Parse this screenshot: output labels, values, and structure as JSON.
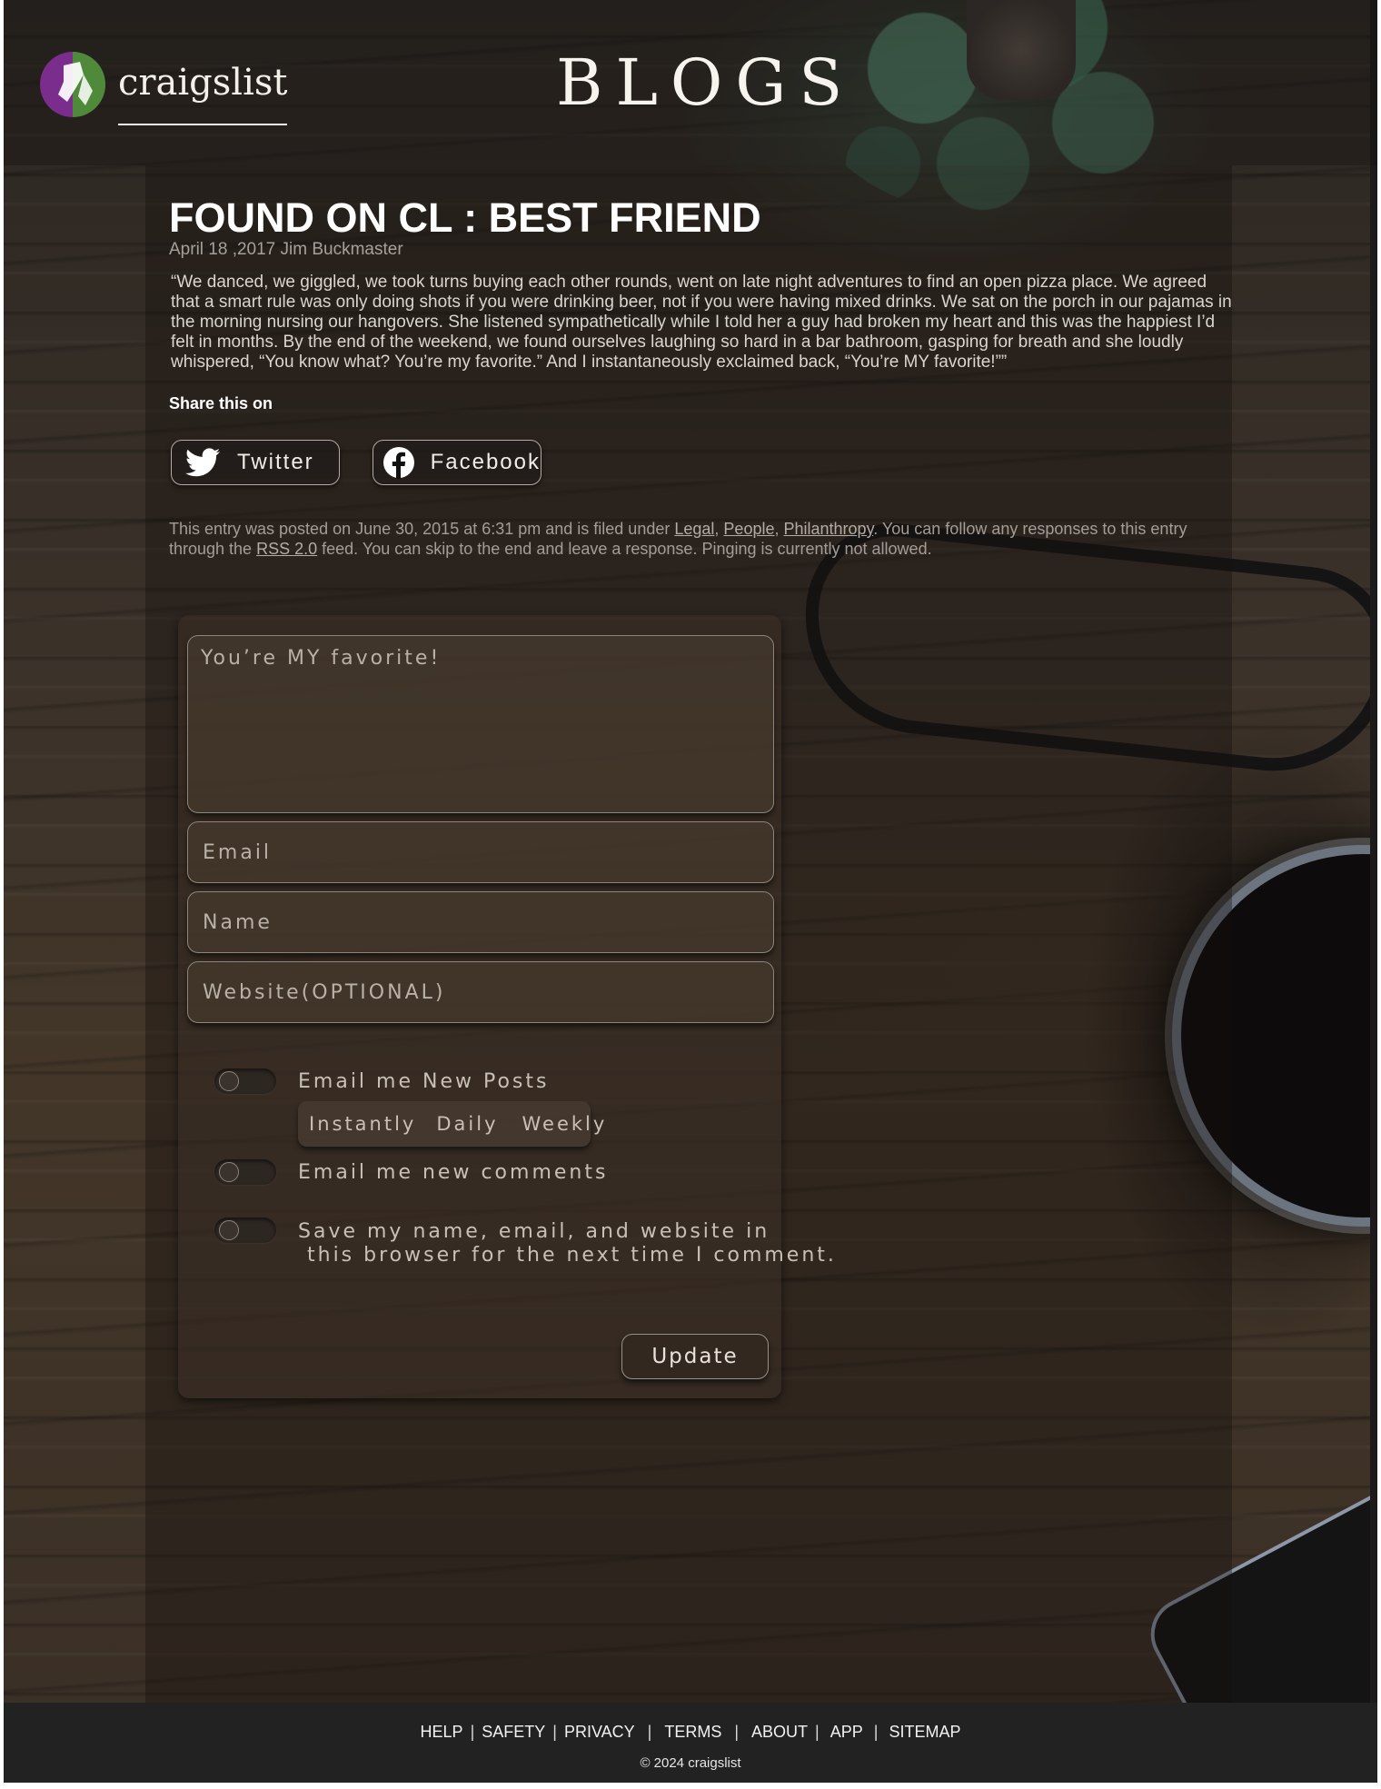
{
  "brand": {
    "name": "craigslist"
  },
  "header": {
    "title": "BLOGS"
  },
  "post": {
    "title": "FOUND ON CL : BEST FRIEND",
    "meta": "April 18 ,2017 Jim Buckmaster",
    "body": "“We danced, we giggled, we took turns buying each other rounds, went on late night adventures to find an open pizza place. We agreed that a smart rule was only doing shots if you were drinking beer, not if you were having mixed drinks. We sat on the porch in our pajamas in the morning nursing our hangovers. She listened sympathetically while I told her a guy had broken my heart and this was the happiest I’d felt in months. By the end of the weekend, we found ourselves laughing so hard in a bar bathroom, gasping for breath and she loudly whispered, “You know what? You’re my favorite.” And I instantaneously exclaimed back, “You’re MY favorite!””"
  },
  "share": {
    "label": "Share this on",
    "twitter": "Twitter",
    "facebook": "Facebook"
  },
  "entry": {
    "prefix": "This entry was posted on June 30, 2015 at 6:31 pm and is filed under ",
    "cat1": "Legal",
    "comma1": ", ",
    "cat2": "People",
    "comma2": ", ",
    "cat3": "Philanthropy",
    "middle": ". You can follow any responses to this entry through the ",
    "rss": "RSS 2.0",
    "suffix": " feed. You can skip to the end and leave a response. Pinging is currently not allowed."
  },
  "form": {
    "comment_value": "You’re MY favorite!",
    "email_placeholder": "Email",
    "name_placeholder": "Name",
    "website_placeholder": "Website(OPTIONAL)",
    "opt_posts": "Email me New Posts",
    "freq_instantly": "Instantly",
    "freq_daily": "Daily",
    "freq_weekly": "Weekly",
    "opt_comments": "Email me new comments",
    "opt_save_line1": "Save my name, email, and website in",
    "opt_save_line2": " this browser for the next time I comment.",
    "update": "Update"
  },
  "footer": {
    "links": [
      "HELP",
      "SAFETY",
      "PRIVACY",
      "TERMS",
      "ABOUT",
      "APP",
      "SITEMAP"
    ],
    "copyright": "© 2024 craigslist"
  },
  "colors": {
    "logo_purple": "#7b2d8e",
    "logo_green": "#4f8a3a",
    "footer_bg": "#222222"
  }
}
